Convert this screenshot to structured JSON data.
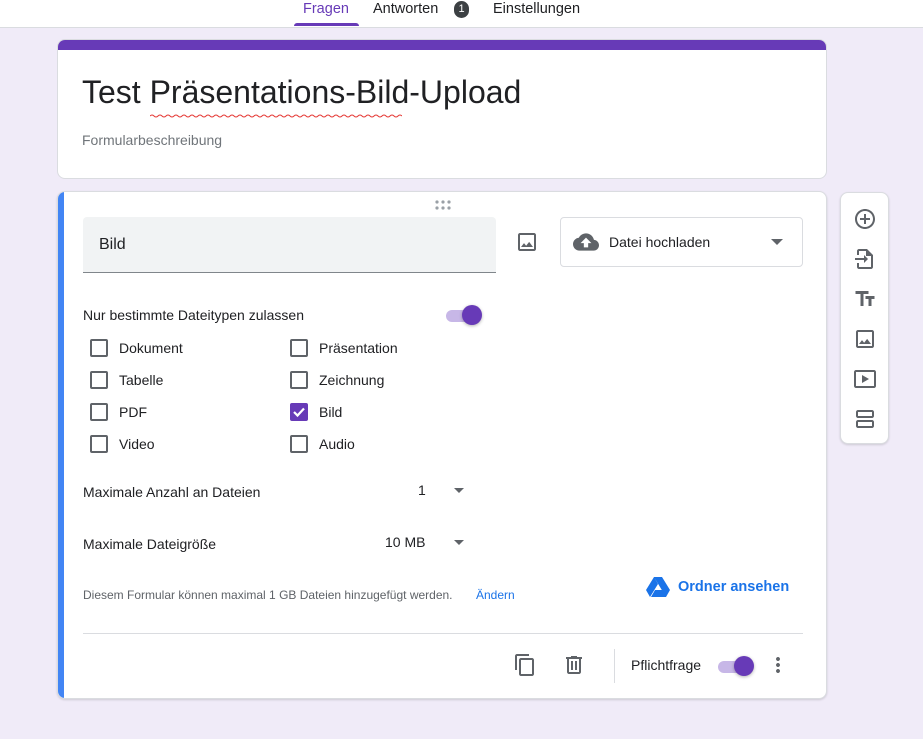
{
  "tabs": {
    "questions": "Fragen",
    "responses": "Antworten",
    "responses_count": "1",
    "settings": "Einstellungen"
  },
  "form": {
    "title": "Test Präsentations-Bild-Upload",
    "description_placeholder": "Formularbeschreibung"
  },
  "question": {
    "title": "Bild",
    "type_label": "Datei hochladen",
    "restrict_label": "Nur bestimmte Dateitypen zulassen",
    "restrict_enabled": true,
    "file_types": [
      {
        "label": "Dokument",
        "checked": false
      },
      {
        "label": "Präsentation",
        "checked": false
      },
      {
        "label": "Tabelle",
        "checked": false
      },
      {
        "label": "Zeichnung",
        "checked": false
      },
      {
        "label": "PDF",
        "checked": false
      },
      {
        "label": "Bild",
        "checked": true
      },
      {
        "label": "Video",
        "checked": false
      },
      {
        "label": "Audio",
        "checked": false
      }
    ],
    "max_files_label": "Maximale Anzahl an Dateien",
    "max_files_value": "1",
    "max_size_label": "Maximale Dateigröße",
    "max_size_value": "10 MB",
    "limit_note": "Diesem Formular können maximal 1 GB Dateien hinzugefügt werden.",
    "change_link": "Ändern",
    "view_folder": "Ordner ansehen",
    "required_label": "Pflichtfrage",
    "required_enabled": true
  },
  "colors": {
    "accent": "#673ab7",
    "active_card": "#4285f4",
    "link": "#1a73e8",
    "background": "#f0ebf8"
  },
  "icons": {
    "side_toolbar": [
      "add-question-icon",
      "import-questions-icon",
      "add-title-icon",
      "add-image-icon",
      "add-video-icon",
      "add-section-icon"
    ],
    "footer": [
      "duplicate-icon",
      "delete-icon",
      "more-options-icon"
    ]
  }
}
